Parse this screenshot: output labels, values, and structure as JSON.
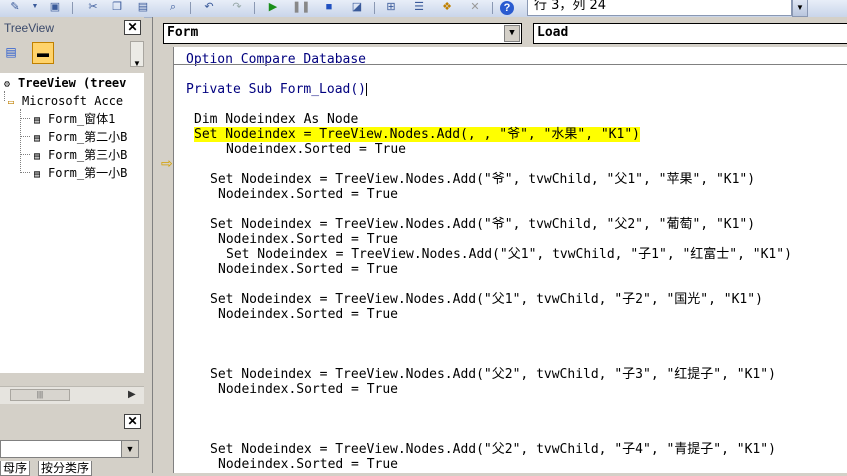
{
  "toolbar": {
    "status_text": "行 3，列 24",
    "icons": [
      "tools-icon",
      "save-icon",
      "cut-icon",
      "copy-icon",
      "paste-icon",
      "find-icon",
      "undo-icon",
      "redo-icon",
      "run-icon",
      "break-icon",
      "reset-icon",
      "design-mode-icon",
      "project-explorer-icon",
      "properties-icon",
      "object-browser-icon",
      "toolbox-icon",
      "help-icon"
    ]
  },
  "project_panel": {
    "title": "TreeView",
    "close_label": "✕",
    "tree": {
      "root_label": "TreeView (treev",
      "folder_label": "Microsoft Acce",
      "items": [
        "Form_窗体1",
        "Form_第二小B",
        "Form_第三小B",
        "Form_第一小B"
      ]
    }
  },
  "properties_panel": {
    "close_label": "✕",
    "tabs": [
      "母序",
      "按分类序"
    ]
  },
  "code_window": {
    "object_combo": "Form",
    "procedure_combo": "Load",
    "lines": [
      "Option Compare Database",
      "Private Sub Form_Load()",
      "Dim Nodeindex As Node",
      "Set Nodeindex = TreeView.Nodes.Add(, , \"爷\", \"水果\", \"K1\")",
      "Nodeindex.Sorted = True",
      "Set Nodeindex = TreeView.Nodes.Add(\"爷\", tvwChild, \"父1\", \"苹果\", \"K1\")",
      "Nodeindex.Sorted = True",
      "Set Nodeindex = TreeView.Nodes.Add(\"爷\", tvwChild, \"父2\", \"葡萄\", \"K1\")",
      "Nodeindex.Sorted = True",
      "Set Nodeindex = TreeView.Nodes.Add(\"父1\", tvwChild, \"子1\", \"红富士\", \"K1\")",
      "Nodeindex.Sorted = True",
      "Set Nodeindex = TreeView.Nodes.Add(\"父1\", tvwChild, \"子2\", \"国光\", \"K1\")",
      "Nodeindex.Sorted = True",
      "Set Nodeindex = TreeView.Nodes.Add(\"父2\", tvwChild, \"子3\", \"红提子\", \"K1\")",
      "Nodeindex.Sorted = True",
      "Set Nodeindex = TreeView.Nodes.Add(\"父2\", tvwChild, \"子4\", \"青提子\", \"K1\")",
      "Nodeindex.Sorted = True"
    ]
  },
  "colors": {
    "highlight": "#ffff00",
    "exec_arrow": "#d4a000"
  }
}
